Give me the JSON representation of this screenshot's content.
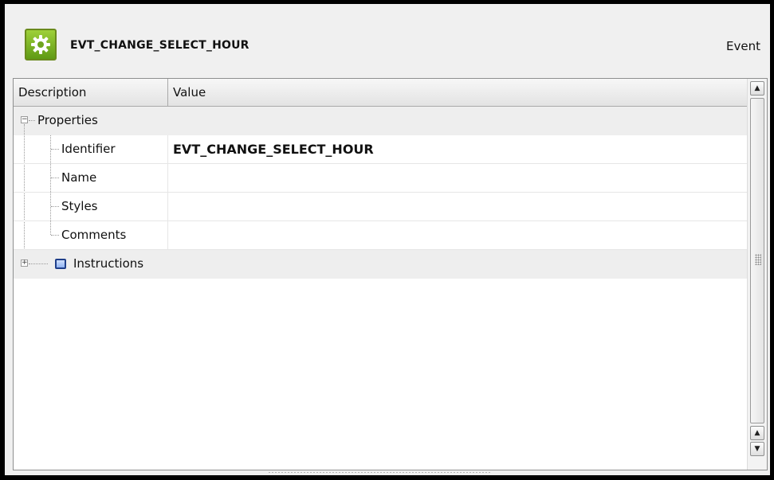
{
  "header": {
    "title": "EVT_CHANGE_SELECT_HOUR",
    "type_label": "Event",
    "icon": "gear-icon",
    "accent_color": "#7cb32a"
  },
  "grid": {
    "columns": [
      "Description",
      "Value"
    ],
    "groups": [
      {
        "label": "Properties",
        "expanded": true,
        "rows": [
          {
            "label": "Identifier",
            "value": "EVT_CHANGE_SELECT_HOUR"
          },
          {
            "label": "Name",
            "value": ""
          },
          {
            "label": "Styles",
            "value": ""
          },
          {
            "label": "Comments",
            "value": ""
          }
        ]
      },
      {
        "label": "Instructions",
        "expanded": false,
        "icon": "instructions-icon"
      }
    ]
  },
  "scrollbar": {
    "up_icon": "scroll-up-icon",
    "down_icon": "scroll-down-icon"
  }
}
